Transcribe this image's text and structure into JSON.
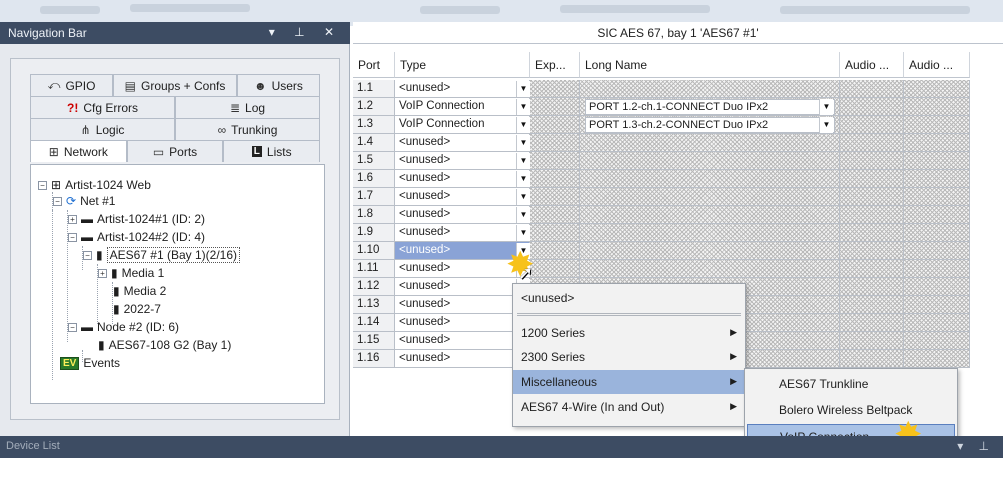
{
  "nav": {
    "title": "Navigation Bar",
    "controls": "▾ ⊥ ✕",
    "tabs_row1": [
      {
        "label": "GPIO",
        "icon": "gpio-icon",
        "glyph": "⤺"
      },
      {
        "label": "Groups + Confs",
        "icon": "groups-icon",
        "glyph": "▤"
      },
      {
        "label": "Users",
        "icon": "users-icon",
        "glyph": "☻"
      }
    ],
    "tabs_row2": [
      {
        "label": "Cfg Errors",
        "icon": "cfg-errors-icon",
        "glyph": "?!"
      },
      {
        "label": "Log",
        "icon": "log-icon",
        "glyph": "≣"
      }
    ],
    "tabs_row3": [
      {
        "label": "Logic",
        "icon": "logic-icon",
        "glyph": "⋔"
      },
      {
        "label": "Trunking",
        "icon": "trunking-icon",
        "glyph": "∞"
      }
    ],
    "tabs_row4": [
      {
        "label": "Network",
        "icon": "network-icon",
        "glyph": "⊞"
      },
      {
        "label": "Ports",
        "icon": "ports-icon",
        "glyph": "▭"
      },
      {
        "label": "Lists",
        "icon": "lists-icon",
        "glyph": "L"
      }
    ],
    "tree": [
      "Artist-1024 Web",
      "Net #1",
      "Artist-1024#1 (ID: 2)",
      "Artist-1024#2 (ID: 4)",
      "AES67 #1 (Bay  1)(2/16)",
      "Media 1",
      "Media 2",
      "2022-7",
      "Node #2 (ID: 6)",
      "AES67-108 G2 (Bay  1)",
      "Events"
    ],
    "events_badge": "EV"
  },
  "panel": {
    "title": "SIC AES 67, bay 1 'AES67 #1'",
    "columns": [
      "Port",
      "Type",
      "Exp...",
      "Long Name",
      "Audio ...",
      "Audio ..."
    ],
    "rows": [
      {
        "port": "1.1",
        "type": "<unused>",
        "long_name": ""
      },
      {
        "port": "1.2",
        "type": "VoIP Connection",
        "long_name": "PORT 1.2-ch.1-CONNECT Duo IPx2"
      },
      {
        "port": "1.3",
        "type": "VoIP Connection",
        "long_name": "PORT 1.3-ch.2-CONNECT Duo IPx2"
      },
      {
        "port": "1.4",
        "type": "<unused>",
        "long_name": ""
      },
      {
        "port": "1.5",
        "type": "<unused>",
        "long_name": ""
      },
      {
        "port": "1.6",
        "type": "<unused>",
        "long_name": ""
      },
      {
        "port": "1.7",
        "type": "<unused>",
        "long_name": ""
      },
      {
        "port": "1.8",
        "type": "<unused>",
        "long_name": ""
      },
      {
        "port": "1.9",
        "type": "<unused>",
        "long_name": ""
      },
      {
        "port": "1.10",
        "type": "<unused>",
        "long_name": ""
      },
      {
        "port": "1.11",
        "type": "<unused>",
        "long_name": ""
      },
      {
        "port": "1.12",
        "type": "<unused>",
        "long_name": ""
      },
      {
        "port": "1.13",
        "type": "<unused>",
        "long_name": ""
      },
      {
        "port": "1.14",
        "type": "<unused>",
        "long_name": ""
      },
      {
        "port": "1.15",
        "type": "<unused>",
        "long_name": ""
      },
      {
        "port": "1.16",
        "type": "<unused>",
        "long_name": ""
      }
    ]
  },
  "context_menu": {
    "items": [
      {
        "label": "<unused>",
        "submenu": false
      },
      {
        "label": "1200 Series",
        "submenu": true
      },
      {
        "label": "2300 Series",
        "submenu": true
      },
      {
        "label": "Miscellaneous",
        "submenu": true
      },
      {
        "label": "AES67 4-Wire (In and Out)",
        "submenu": true
      }
    ]
  },
  "submenu": {
    "items": [
      "AES67 Trunkline",
      "Bolero Wireless Beltpack",
      "VoIP Connection"
    ]
  },
  "device_bar": {
    "title": "Device List",
    "controls": "▾ ⊥"
  },
  "colors": {
    "titlebar": "#3d4c63",
    "selection": "#8aa3d6",
    "highlight": "#9ab4dc",
    "burst": "#f7c21b"
  }
}
